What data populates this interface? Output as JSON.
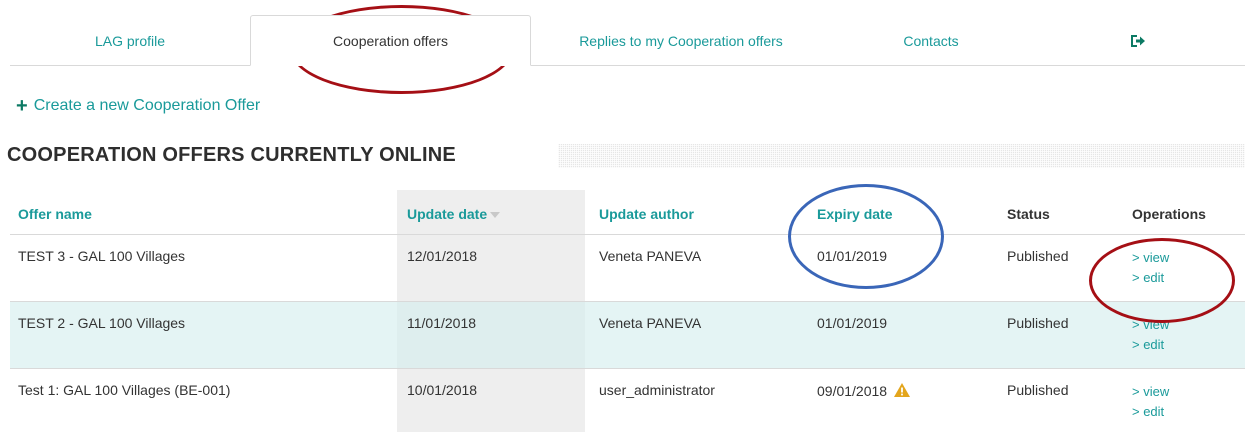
{
  "tabs": [
    {
      "label": "LAG profile"
    },
    {
      "label": "Cooperation offers"
    },
    {
      "label": "Replies to my Cooperation offers"
    },
    {
      "label": "Contacts"
    }
  ],
  "logout_icon": "logout-icon",
  "create_link": {
    "icon": "plus-icon",
    "label": "Create a new Cooperation Offer"
  },
  "section_title": "COOPERATION OFFERS CURRENTLY ONLINE",
  "table": {
    "headers": {
      "offer_name": "Offer name",
      "update_date": "Update date",
      "update_author": "Update author",
      "expiry_date": "Expiry date",
      "status": "Status",
      "operations": "Operations"
    },
    "rows": [
      {
        "offer_name": "TEST 3 - GAL 100 Villages",
        "update_date": "12/01/2018",
        "update_author": "Veneta PANEVA",
        "expiry_date": "01/01/2019",
        "status": "Published",
        "view": "> view",
        "edit": "> edit"
      },
      {
        "offer_name": "TEST 2 - GAL 100 Villages",
        "update_date": "11/01/2018",
        "update_author": "Veneta PANEVA",
        "expiry_date": "01/01/2019",
        "status": "Published",
        "view": "> view",
        "edit": "> edit"
      },
      {
        "offer_name": "Test 1: GAL 100 Villages (BE-001)",
        "update_date": "10/01/2018",
        "update_author": "user_administrator",
        "expiry_date": "09/01/2018",
        "expiry_warning_icon": "warning-icon",
        "status": "Published",
        "view": "> view",
        "edit": "> edit"
      }
    ]
  },
  "colors": {
    "accent": "#1a9a9a",
    "annotation_red": "#a50f15",
    "annotation_blue": "#3a66b8",
    "warning": "#e3a51c"
  }
}
